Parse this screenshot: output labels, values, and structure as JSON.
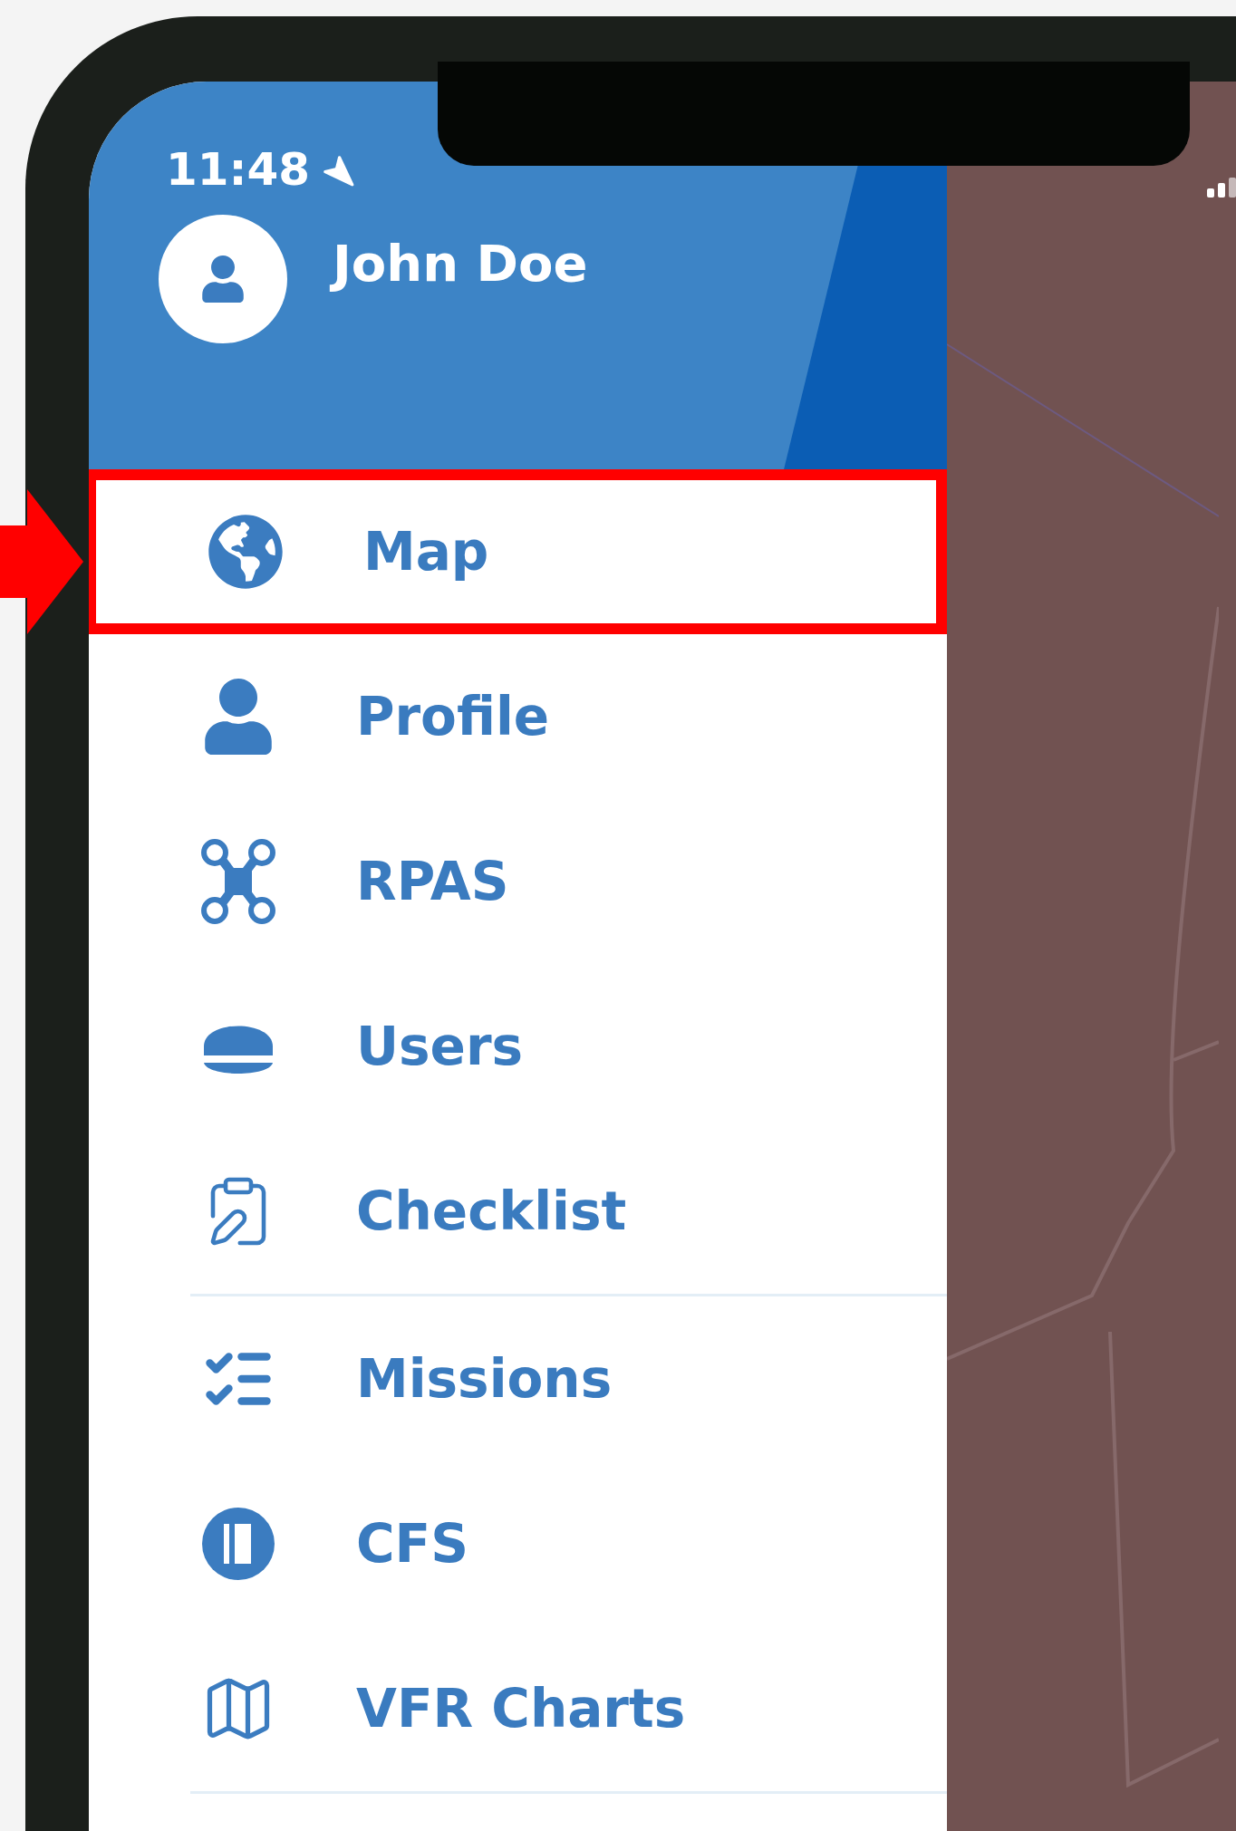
{
  "status_bar": {
    "time": "11:48"
  },
  "drawer": {
    "user_name": "John Doe",
    "items": [
      {
        "label": "Map",
        "selected": true,
        "divider_below": false
      },
      {
        "label": "Profile",
        "selected": false,
        "divider_below": false
      },
      {
        "label": "RPAS",
        "selected": false,
        "divider_below": false
      },
      {
        "label": "Users",
        "selected": false,
        "divider_below": false
      },
      {
        "label": "Checklist",
        "selected": false,
        "divider_below": true
      },
      {
        "label": "Missions",
        "selected": false,
        "divider_below": false
      },
      {
        "label": "CFS",
        "selected": false,
        "divider_below": false
      },
      {
        "label": "VFR Charts",
        "selected": false,
        "divider_below": true
      }
    ]
  }
}
